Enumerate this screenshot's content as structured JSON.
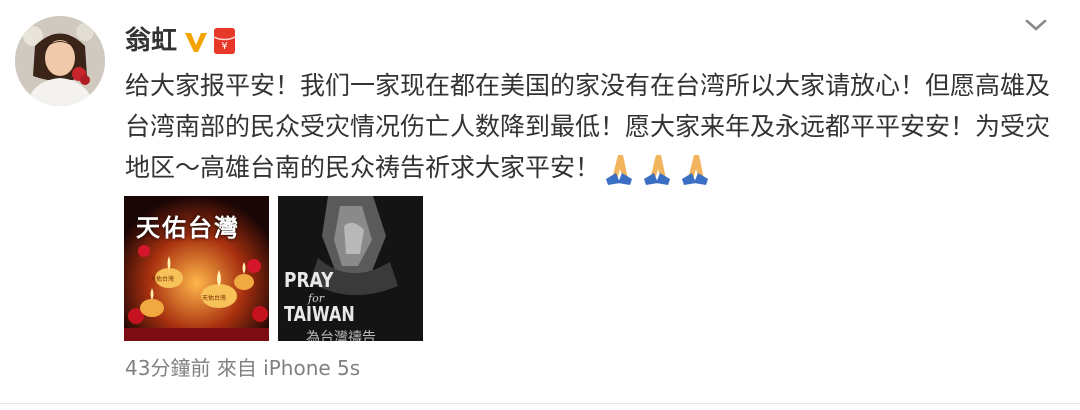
{
  "post": {
    "author": {
      "name": "翁虹",
      "verified_icon": "verified-v-icon",
      "member_icon": "member-badge-icon",
      "accent_color": "#f5a300",
      "member_color": "#e83828"
    },
    "text": "给大家报平安！我们一家现在都在美国的家没有在台湾所以大家请放心！但愿高雄及台湾南部的民众受灾情况伤亡人数降到最低！愿大家来年及永远都平平安安！为受灾地区～高雄台南的民众祷告祈求大家平安！",
    "emoji": [
      "folded-hands",
      "folded-hands",
      "folded-hands"
    ],
    "images": [
      {
        "title": "天佑台灣",
        "candle_labels": [
          "天佑台灣",
          "天佑台灣"
        ]
      },
      {
        "line1": "PRAY",
        "line2": "for",
        "line3": "TAIWAN",
        "subtitle": "為台灣禱告"
      }
    ],
    "time": "43分鐘前",
    "source": "來自 iPhone 5s",
    "menu_icon": "chevron-down-icon"
  }
}
